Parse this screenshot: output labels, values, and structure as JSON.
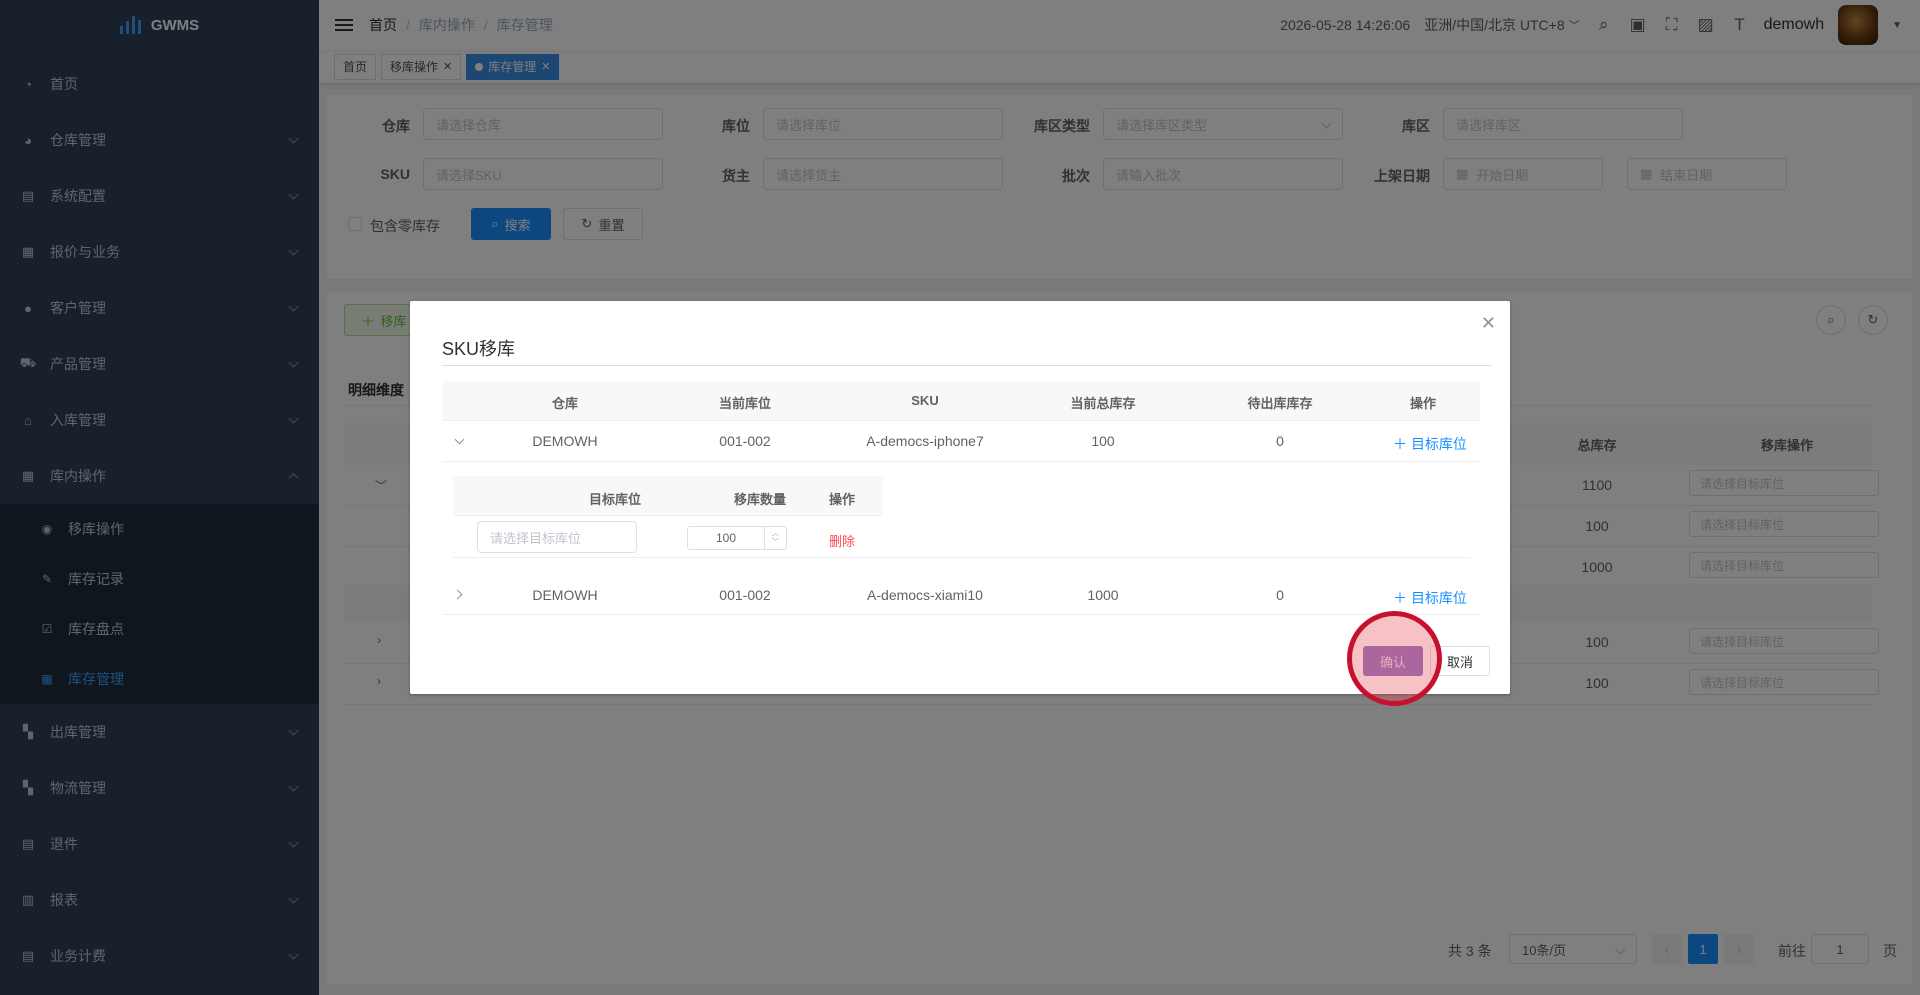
{
  "app": {
    "logo_text": "GWMS"
  },
  "sidebar": {
    "items": [
      {
        "label": "首页",
        "icon": "dashboard-icon"
      },
      {
        "label": "仓库管理",
        "icon": "globe-icon"
      },
      {
        "label": "系统配置",
        "icon": "config-icon"
      },
      {
        "label": "报价与业务",
        "icon": "quote-icon"
      },
      {
        "label": "客户管理",
        "icon": "user-icon"
      },
      {
        "label": "产品管理",
        "icon": "cart-icon"
      },
      {
        "label": "入库管理",
        "icon": "home-icon"
      },
      {
        "label": "库内操作",
        "icon": "table-icon"
      }
    ],
    "sub_items": [
      {
        "label": "移库操作",
        "icon": "eye-icon"
      },
      {
        "label": "库存记录",
        "icon": "edit-icon"
      },
      {
        "label": "库存盘点",
        "icon": "checkbox-icon"
      },
      {
        "label": "库存管理",
        "icon": "grid-icon"
      }
    ],
    "items_after": [
      {
        "label": "出库管理",
        "icon": "apps-icon"
      },
      {
        "label": "物流管理",
        "icon": "apps-icon"
      },
      {
        "label": "退件",
        "icon": "return-icon"
      },
      {
        "label": "报表",
        "icon": "chart-icon"
      },
      {
        "label": "业务计费",
        "icon": "billing-icon"
      }
    ]
  },
  "navbar": {
    "breadcrumb": [
      "首页",
      "库内操作",
      "库存管理"
    ],
    "datetime": "2026-05-28 14:26:06",
    "timezone": "亚洲/中国/北京 UTC+8",
    "username": "demowh"
  },
  "tags": [
    {
      "label": "首页"
    },
    {
      "label": "移库操作"
    },
    {
      "label": "库存管理"
    }
  ],
  "filters": {
    "warehouse_label": "仓库",
    "warehouse_placeholder": "请选择仓库",
    "location_label": "库位",
    "location_placeholder": "请选择库位",
    "zone_type_label": "库区类型",
    "zone_type_placeholder": "请选择库区类型",
    "zone_label": "库区",
    "zone_placeholder": "请选择库区",
    "sku_label": "SKU",
    "sku_placeholder": "请选择SKU",
    "owner_label": "货主",
    "owner_placeholder": "请选择货主",
    "batch_label": "批次",
    "batch_placeholder": "请输入批次",
    "shelf_date_label": "上架日期",
    "start_date_placeholder": "开始日期",
    "end_date_placeholder": "结束日期",
    "include_zero_label": "包含零库存",
    "search_label": "搜索",
    "reset_label": "重置"
  },
  "list": {
    "move_button_label": "移库",
    "dimension_label": "明细维度",
    "col_total": "总库存",
    "col_move_op": "移库操作",
    "rows": [
      {
        "total": "1100",
        "placeholder": "请选择目标库位"
      },
      {
        "total": "100",
        "placeholder": "请选择目标库位"
      },
      {
        "total": "1000",
        "placeholder": "请选择目标库位"
      },
      {
        "total": "100",
        "placeholder": "请选择目标库位"
      },
      {
        "total": "100",
        "placeholder": "请选择目标库位"
      }
    ]
  },
  "pagination": {
    "total_text": "共 3 条",
    "page_size": "10条/页",
    "current_page": "1",
    "goto_label": "前往",
    "goto_value": "1",
    "page_suffix": "页"
  },
  "dialog": {
    "title": "SKU移库",
    "columns": [
      "仓库",
      "当前库位",
      "SKU",
      "当前总库存",
      "待出库库存",
      "操作"
    ],
    "rows": [
      {
        "warehouse": "DEMOWH",
        "location": "001-002",
        "sku": "A-democs-iphone7",
        "total": "100",
        "pending": "0",
        "action": "目标库位"
      },
      {
        "warehouse": "DEMOWH",
        "location": "001-002",
        "sku": "A-democs-xiami10",
        "total": "1000",
        "pending": "0",
        "action": "目标库位"
      }
    ],
    "sub_columns": [
      "目标库位",
      "移库数量",
      "操作"
    ],
    "sub_row": {
      "placeholder": "请选择目标库位",
      "quantity": "100",
      "action": "删除"
    },
    "confirm_label": "确认",
    "cancel_label": "取消"
  }
}
